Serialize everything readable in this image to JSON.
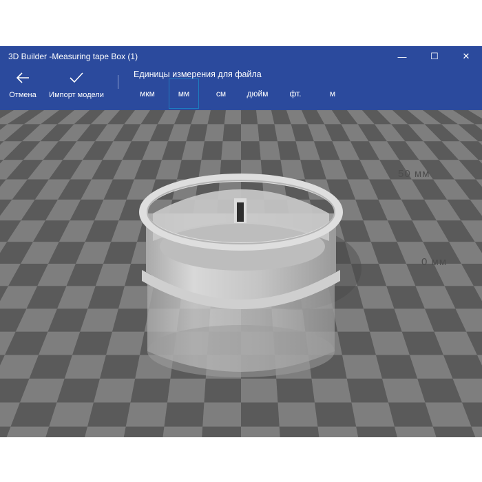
{
  "window": {
    "title": "3D Builder -Measuring tape Box (1)",
    "controls": {
      "minimize": "—",
      "maximize": "☐",
      "close": "✕"
    }
  },
  "toolbar": {
    "cancel_label": "Отмена",
    "cancel_icon": "arrow-left-icon",
    "import_label": "Импорт модели",
    "import_icon": "checkmark-icon",
    "units_heading": "Единицы измерения для файла",
    "units": [
      "мкм",
      "мм",
      "см",
      "дюйм",
      "фт.",
      "м"
    ],
    "selected_unit": "мм"
  },
  "scene": {
    "scale_labels": [
      "50 мм",
      "0 мм"
    ]
  },
  "colors": {
    "title_bar": "#2b4a9d",
    "selection_border": "#1e7bbf",
    "floor_dark": "#5a5a5a",
    "floor_light": "#7e7e7e"
  }
}
